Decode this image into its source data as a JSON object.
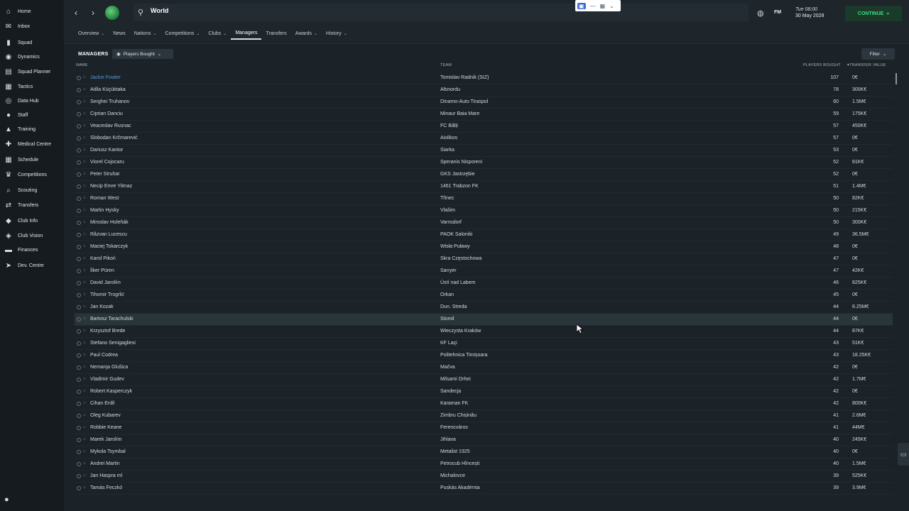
{
  "sidebar": {
    "items": [
      {
        "label": "Home",
        "icon": "home-icon",
        "glyph": "⌂"
      },
      {
        "label": "Inbox",
        "icon": "inbox-icon",
        "glyph": "✉"
      },
      {
        "label": "Squad",
        "icon": "squad-icon",
        "glyph": "▮"
      },
      {
        "label": "Dynamics",
        "icon": "dynamics-icon",
        "glyph": "◉"
      },
      {
        "label": "Squad Planner",
        "icon": "planner-icon",
        "glyph": "▤"
      },
      {
        "label": "Tactics",
        "icon": "tactics-icon",
        "glyph": "▦"
      },
      {
        "label": "Data Hub",
        "icon": "data-hub-icon",
        "glyph": "◎"
      },
      {
        "label": "Staff",
        "icon": "staff-icon",
        "glyph": "●"
      },
      {
        "label": "Training",
        "icon": "training-icon",
        "glyph": "▲"
      },
      {
        "label": "Medical Centre",
        "icon": "medical-icon",
        "glyph": "✚"
      },
      {
        "label": "Schedule",
        "icon": "schedule-icon",
        "glyph": "▦"
      },
      {
        "label": "Competitions",
        "icon": "trophy-icon",
        "glyph": "♛"
      },
      {
        "label": "Scouting",
        "icon": "scouting-icon",
        "glyph": "⌕"
      },
      {
        "label": "Transfers",
        "icon": "transfers-icon",
        "glyph": "⇄"
      },
      {
        "label": "Club Info",
        "icon": "club-info-icon",
        "glyph": "◆"
      },
      {
        "label": "Club Vision",
        "icon": "vision-icon",
        "glyph": "◈"
      },
      {
        "label": "Finances",
        "icon": "finances-icon",
        "glyph": "▬"
      },
      {
        "label": "Dev. Centre",
        "icon": "dev-centre-icon",
        "glyph": "➤"
      }
    ]
  },
  "header": {
    "search_text": "World",
    "date_day": "Tue 08:00",
    "date_full": "30 May 2028",
    "brand": "FM",
    "continue_label": "CONTINUE",
    "tabs": [
      {
        "label": "Overview",
        "dropdown": true
      },
      {
        "label": "News",
        "dropdown": false
      },
      {
        "label": "Nations",
        "dropdown": true
      },
      {
        "label": "Competitions",
        "dropdown": true
      },
      {
        "label": "Clubs",
        "dropdown": true
      },
      {
        "label": "Managers",
        "dropdown": false,
        "active": true
      },
      {
        "label": "Transfers",
        "dropdown": false
      },
      {
        "label": "Awards",
        "dropdown": true
      },
      {
        "label": "History",
        "dropdown": true
      }
    ]
  },
  "panel": {
    "title": "MANAGERS",
    "view_label": "Players Bought",
    "filter_label": "Filter",
    "columns": {
      "name": "NAME",
      "team": "TEAM",
      "players_bought": "PLAYERS BOUGHT",
      "transfer_value": "TRANSFER VALUE"
    }
  },
  "rows": [
    {
      "name": "Jackie Fowler",
      "team": "Tomislav Radnik (SIZ)",
      "pb": "107",
      "tv": "0€"
    },
    {
      "name": "Atilla Küçüktaka",
      "team": "Altınordu",
      "pb": "78",
      "tv": "300K€"
    },
    {
      "name": "Serghei Truhanov",
      "team": "Dinamo-Auto Tiraspol",
      "pb": "60",
      "tv": "1.5M€"
    },
    {
      "name": "Ciprian Danciu",
      "team": "Minaur Baia Mare",
      "pb": "59",
      "tv": "175K€"
    },
    {
      "name": "Veaceslav Rusnac",
      "team": "FC Bălți",
      "pb": "57",
      "tv": "450K€"
    },
    {
      "name": "Slobodan Krčmarević",
      "team": "Aiolikos",
      "pb": "57",
      "tv": "0€"
    },
    {
      "name": "Dariusz Kantor",
      "team": "Siarka",
      "pb": "53",
      "tv": "0€"
    },
    {
      "name": "Viorel Cojocaru",
      "team": "Speranis Nisporeni",
      "pb": "52",
      "tv": "81K€"
    },
    {
      "name": "Peter Struhar",
      "team": "GKS Jastrzębie",
      "pb": "52",
      "tv": "0€"
    },
    {
      "name": "Necip Emre Yilmaz",
      "team": "1461 Trabzon FK",
      "pb": "51",
      "tv": "1.4M€"
    },
    {
      "name": "Roman West",
      "team": "Třinec",
      "pb": "50",
      "tv": "82K€"
    },
    {
      "name": "Martin Hysky",
      "team": "Vlašim",
      "pb": "50",
      "tv": "215K€"
    },
    {
      "name": "Miroslav Holeňák",
      "team": "Varnsdorf",
      "pb": "50",
      "tv": "300K€"
    },
    {
      "name": "Răzvan Lucescu",
      "team": "PAOK Saloniki",
      "pb": "49",
      "tv": "36.5M€"
    },
    {
      "name": "Maciej Tokarczyk",
      "team": "Wisła Puławy",
      "pb": "48",
      "tv": "0€"
    },
    {
      "name": "Karol Pikoń",
      "team": "Skra Częstochowa",
      "pb": "47",
      "tv": "0€"
    },
    {
      "name": "İlker Püren",
      "team": "Sarıyer",
      "pb": "47",
      "tv": "42K€"
    },
    {
      "name": "David Jarolím",
      "team": "Ústí nad Labem",
      "pb": "46",
      "tv": "825K€"
    },
    {
      "name": "Tihomir Trogrlić",
      "team": "Orkan",
      "pb": "45",
      "tv": "0€"
    },
    {
      "name": "Jan Kozak",
      "team": "Dun. Streda",
      "pb": "44",
      "tv": "8.25M€"
    },
    {
      "name": "Bartosz Tarachulski",
      "team": "Stomil",
      "pb": "44",
      "tv": "0€",
      "highlight": true
    },
    {
      "name": "Krzysztof Brede",
      "team": "Wieczysta Kraków",
      "pb": "44",
      "tv": "87K€"
    },
    {
      "name": "Stefano Senigagliesi",
      "team": "KF Laçi",
      "pb": "43",
      "tv": "51K€"
    },
    {
      "name": "Paul Codrea",
      "team": "Politehnica Timișoara",
      "pb": "43",
      "tv": "18.25K€"
    },
    {
      "name": "Nemanja Glušica",
      "team": "Mačva",
      "pb": "42",
      "tv": "0€"
    },
    {
      "name": "Vladimir Gudev",
      "team": "Milsami Orhei",
      "pb": "42",
      "tv": "1.7M€"
    },
    {
      "name": "Robert Kasperczyk",
      "team": "Sandecja",
      "pb": "42",
      "tv": "0€"
    },
    {
      "name": "Cihan Erdil",
      "team": "Karaman FK",
      "pb": "42",
      "tv": "800K€"
    },
    {
      "name": "Oleg Kubarev",
      "team": "Zimbru Chișinău",
      "pb": "41",
      "tv": "2.6M€"
    },
    {
      "name": "Robbie Keane",
      "team": "Ferencváros",
      "pb": "41",
      "tv": "44M€"
    },
    {
      "name": "Marek Jarolím",
      "team": "Jihlava",
      "pb": "40",
      "tv": "245K€"
    },
    {
      "name": "Mykola Tsymbal",
      "team": "Metalist 1925",
      "pb": "40",
      "tv": "0€"
    },
    {
      "name": "Andrei Martin",
      "team": "Petrocub Hîncești",
      "pb": "40",
      "tv": "1.5M€"
    },
    {
      "name": "Jan Haspra ml",
      "team": "Michalovce",
      "pb": "39",
      "tv": "525K€"
    },
    {
      "name": "Tamás Feczkó",
      "team": "Puskás Akadémia",
      "pb": "39",
      "tv": "3.9M€"
    }
  ]
}
